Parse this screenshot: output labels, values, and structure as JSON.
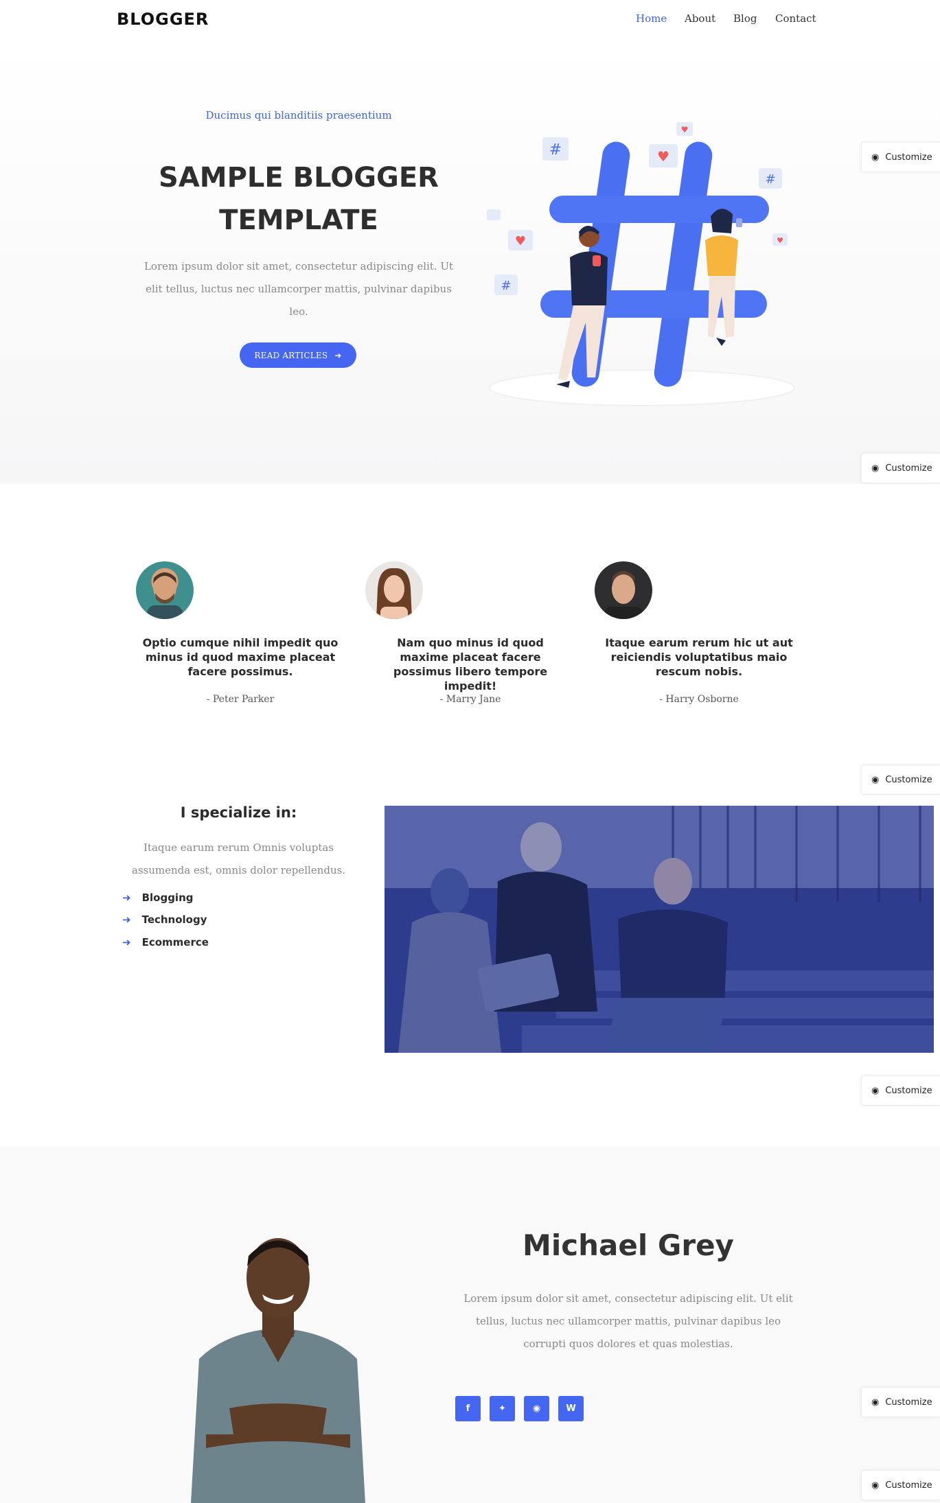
{
  "brand": "BLOGGER",
  "nav": [
    "Home",
    "About",
    "Blog",
    "Contact"
  ],
  "hero": {
    "kicker": "Ducimus qui blanditiis praesentium",
    "title_line1": "SAMPLE BLOGGER",
    "title_line2": "TEMPLATE",
    "text": "Lorem ipsum dolor sit amet, consectetur adipiscing elit. Ut elit tellus, luctus nec ullamcorper mattis, pulvinar dapibus leo.",
    "button": "READ ARTICLES"
  },
  "customize_label": "Customize",
  "testimonials": [
    {
      "quote": "Optio cumque nihil impedit quo minus id quod maxime placeat facere possimus.",
      "author": "- Peter Parker"
    },
    {
      "quote": "Nam quo minus id quod maxime placeat facere possimus libero tempore impedit!",
      "author": "- Marry Jane"
    },
    {
      "quote": "Itaque earum rerum hic ut aut reiciendis voluptatibus maio rescum nobis.",
      "author": "- Harry Osborne"
    }
  ],
  "specialize": {
    "title": "I specialize in:",
    "text": "Itaque earum rerum Omnis voluptas assumenda est, omnis dolor repellendus.",
    "items": [
      "Blogging",
      "Technology",
      "Ecommerce"
    ]
  },
  "profile": {
    "name": "Michael Grey",
    "text": "Lorem ipsum dolor sit amet, consectetur adipiscing elit. Ut elit tellus, luctus nec ullamcorper mattis, pulvinar dapibus leo corrupti quos dolores et quas molestias.",
    "social": [
      "facebook-icon",
      "twitter-icon",
      "instagram-icon",
      "wordpress-icon"
    ]
  },
  "colors": {
    "accent": "#4566f0",
    "overlay": "#2d3c8c"
  }
}
